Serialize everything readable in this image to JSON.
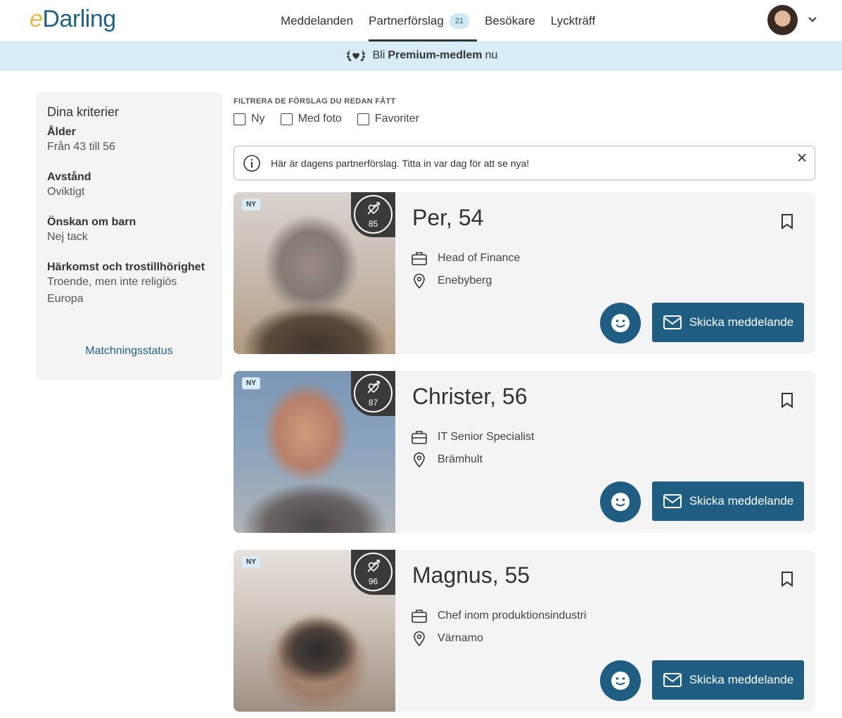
{
  "header": {
    "logo_e": "e",
    "logo_rest": "Darling",
    "nav": [
      {
        "label": "Meddelanden",
        "active": false
      },
      {
        "label": "Partnerförslag",
        "active": true,
        "badge": "21"
      },
      {
        "label": "Besökare",
        "active": false
      },
      {
        "label": "Lyckträff",
        "active": false
      }
    ]
  },
  "premium": {
    "pre": "Bli",
    "bold": "Premium-medlem",
    "post": "nu"
  },
  "sidebar": {
    "title": "Dina kriterier",
    "criteria": [
      {
        "title": "Ålder",
        "value": "Från 43 till 56"
      },
      {
        "title": "Avstånd",
        "value": "Oviktigt"
      },
      {
        "title": "Önskan om barn",
        "value": "Nej tack"
      },
      {
        "title": "Härkomst och trostillhörighet",
        "value": "Troende, men inte religiös",
        "value2": "Europa"
      }
    ],
    "link": "Matchningsstatus"
  },
  "filters": {
    "title": "FILTRERA DE FÖRSLAG DU REDAN FÅTT",
    "options": [
      "Ny",
      "Med foto",
      "Favoriter"
    ]
  },
  "info": {
    "message": "Här är dagens partnerförslag. Titta in var dag för att se nya!"
  },
  "cards": [
    {
      "badge": "NY",
      "score": "85",
      "name": "Per, 54",
      "job": "Head of Finance",
      "location": "Enebyberg",
      "send_label": "Skicka meddelande"
    },
    {
      "badge": "NY",
      "score": "87",
      "name": "Christer, 56",
      "job": "IT Senior Specialist",
      "location": "Brämhult",
      "send_label": "Skicka meddelande"
    },
    {
      "badge": "NY",
      "score": "96",
      "name": "Magnus, 55",
      "job": "Chef inom produktionsindustri",
      "location": "Värnamo",
      "send_label": "Skicka meddelande"
    }
  ],
  "colors": {
    "brand": "#1f5d82",
    "premium_bg": "#d7ecf7",
    "card_bg": "#f4f4f4"
  }
}
